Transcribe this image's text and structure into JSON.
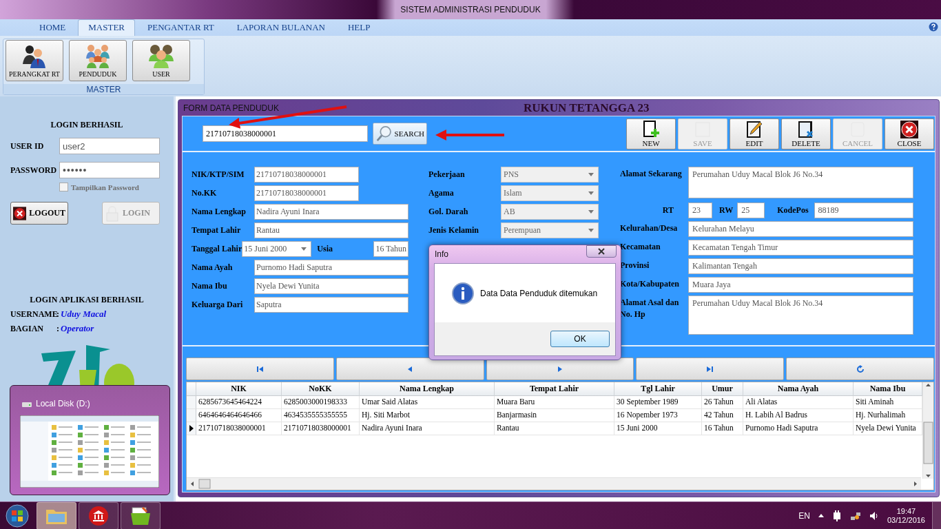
{
  "window": {
    "title": "SISTEM ADMINISTRASI PENDUDUK"
  },
  "menu_tabs": [
    {
      "label": "HOME",
      "selected": false
    },
    {
      "label": "MASTER",
      "selected": true
    },
    {
      "label": "PENGANTAR RT",
      "selected": false
    },
    {
      "label": "LAPORAN BULANAN",
      "selected": false
    },
    {
      "label": "HELP",
      "selected": false
    }
  ],
  "ribbon": {
    "buttons": [
      "PERANGKAT RT",
      "PENDUDUK",
      "USER"
    ],
    "group_label": "MASTER"
  },
  "login": {
    "heading": "LOGIN BERHASIL",
    "user_id_label": "USER ID",
    "user_id": "user2",
    "password_label": "PASSWORD",
    "password": "••••••",
    "show_password": {
      "label": "Tampilkan Password",
      "checked": false
    },
    "buttons": [
      {
        "label": "LOGOUT",
        "disabled": false
      },
      {
        "label": "LOGIN",
        "disabled": true
      }
    ],
    "status_heading": "LOGIN APLIKASI BERHASIL",
    "info": [
      {
        "label": "USERNAME",
        "separator": ":",
        "value": "Uduy Macal"
      },
      {
        "label": "BAGIAN",
        "separator": ":",
        "value": "Operator"
      }
    ]
  },
  "form": {
    "title": "FORM DATA PENDUDUK",
    "background_title": "RUKUN TETANGGA 23",
    "search": {
      "value": "21710718038000001",
      "button": "SEARCH"
    },
    "toolbar": [
      {
        "label": "NEW",
        "disabled": false
      },
      {
        "label": "SAVE",
        "disabled": true
      },
      {
        "label": "EDIT",
        "disabled": false
      },
      {
        "label": "DELETE",
        "disabled": false
      },
      {
        "label": "CANCEL",
        "disabled": true
      },
      {
        "label": "CLOSE",
        "disabled": false
      }
    ],
    "fields_left": [
      {
        "kind": "short",
        "label": "NIK/KTP/SIM",
        "value": "21710718038000001"
      },
      {
        "kind": "short",
        "label": "No.KK",
        "value": "21710718038000001"
      },
      {
        "kind": "text",
        "label": "Nama Lengkap",
        "value": "Nadira Ayuni Inara"
      },
      {
        "kind": "text",
        "label": "Tempat Lahir",
        "value": "Rantau"
      },
      {
        "kind": "date",
        "label": "Tanggal Lahir",
        "value": "15 Juni 2000",
        "extra_label": "Usia",
        "extra_value": "16 Tahun"
      },
      {
        "kind": "text",
        "label": "Nama Ayah",
        "value": "Purnomo Hadi Saputra"
      },
      {
        "kind": "text",
        "label": "Nama Ibu",
        "value": "Nyela Dewi Yunita"
      },
      {
        "kind": "text",
        "label": "Keluarga Dari",
        "value": "Saputra"
      }
    ],
    "fields_middle": [
      {
        "label": "Pekerjaan",
        "value": "PNS"
      },
      {
        "label": "Agama",
        "value": "Islam"
      },
      {
        "label": "Gol. Darah",
        "value": "AB"
      },
      {
        "label": "Jenis Kelamin",
        "value": "Perempuan"
      }
    ],
    "fields_right": [
      {
        "kind": "area",
        "label": "Alamat Sekarang",
        "value": "Perumahan Uduy Macal Blok J6 No.34"
      },
      {
        "kind": "rt",
        "label": "RT",
        "value": "23",
        "rw_label": "RW",
        "rw_value": "25",
        "postcode_label": "KodePos",
        "postcode_value": "88189"
      },
      {
        "kind": "text",
        "label": "Kelurahan/Desa",
        "value": "Kelurahan Melayu"
      },
      {
        "kind": "text",
        "label": "Kecamatan",
        "value": "Kecamatan Tengah Timur"
      },
      {
        "kind": "text",
        "label": "Provinsi",
        "value": "Kalimantan Tengah"
      },
      {
        "kind": "text",
        "label": "Kota/Kabupaten",
        "value": "Muara Jaya"
      },
      {
        "kind": "area",
        "label": "Alamat Asal dan No. Hp",
        "value": "Perumahan Uduy Macal Blok J6 No.34"
      }
    ]
  },
  "table": {
    "columns": [
      "NIK",
      "NoKK",
      "Nama Lengkap",
      "Tempat Lahir",
      "Tgl Lahir",
      "Umur",
      "Nama Ayah",
      "Nama Ibu"
    ],
    "rows": [
      {
        "selected": false,
        "cells": [
          "6285673645464224",
          "6285003000198333",
          "Umar Said Alatas",
          "Muara Baru",
          "30 September 1989",
          "26 Tahun",
          "Ali Alatas",
          "Siti Aminah"
        ]
      },
      {
        "selected": false,
        "cells": [
          "6464646464646466",
          "4634535555355555",
          "Hj. Siti Marbot",
          "Banjarmasin",
          "16 Nopember 1973",
          "42 Tahun",
          "H. Labih Al Badrus",
          "Hj. Nurhalimah"
        ]
      },
      {
        "selected": true,
        "cells": [
          "21710718038000001",
          "21710718038000001",
          "Nadira Ayuni Inara",
          "Rantau",
          "15 Juni 2000",
          "16 Tahun",
          "Purnomo Hadi Saputra",
          "Nyela Dewi Yunita"
        ]
      }
    ]
  },
  "dialog": {
    "title": "Info",
    "message": "Data Data Penduduk ditemukan",
    "button": "OK"
  },
  "taskbar_preview": {
    "title": "Local Disk (D:)"
  },
  "taskbar": {
    "language": "EN",
    "time": "19:47",
    "date": "03/12/2016"
  }
}
